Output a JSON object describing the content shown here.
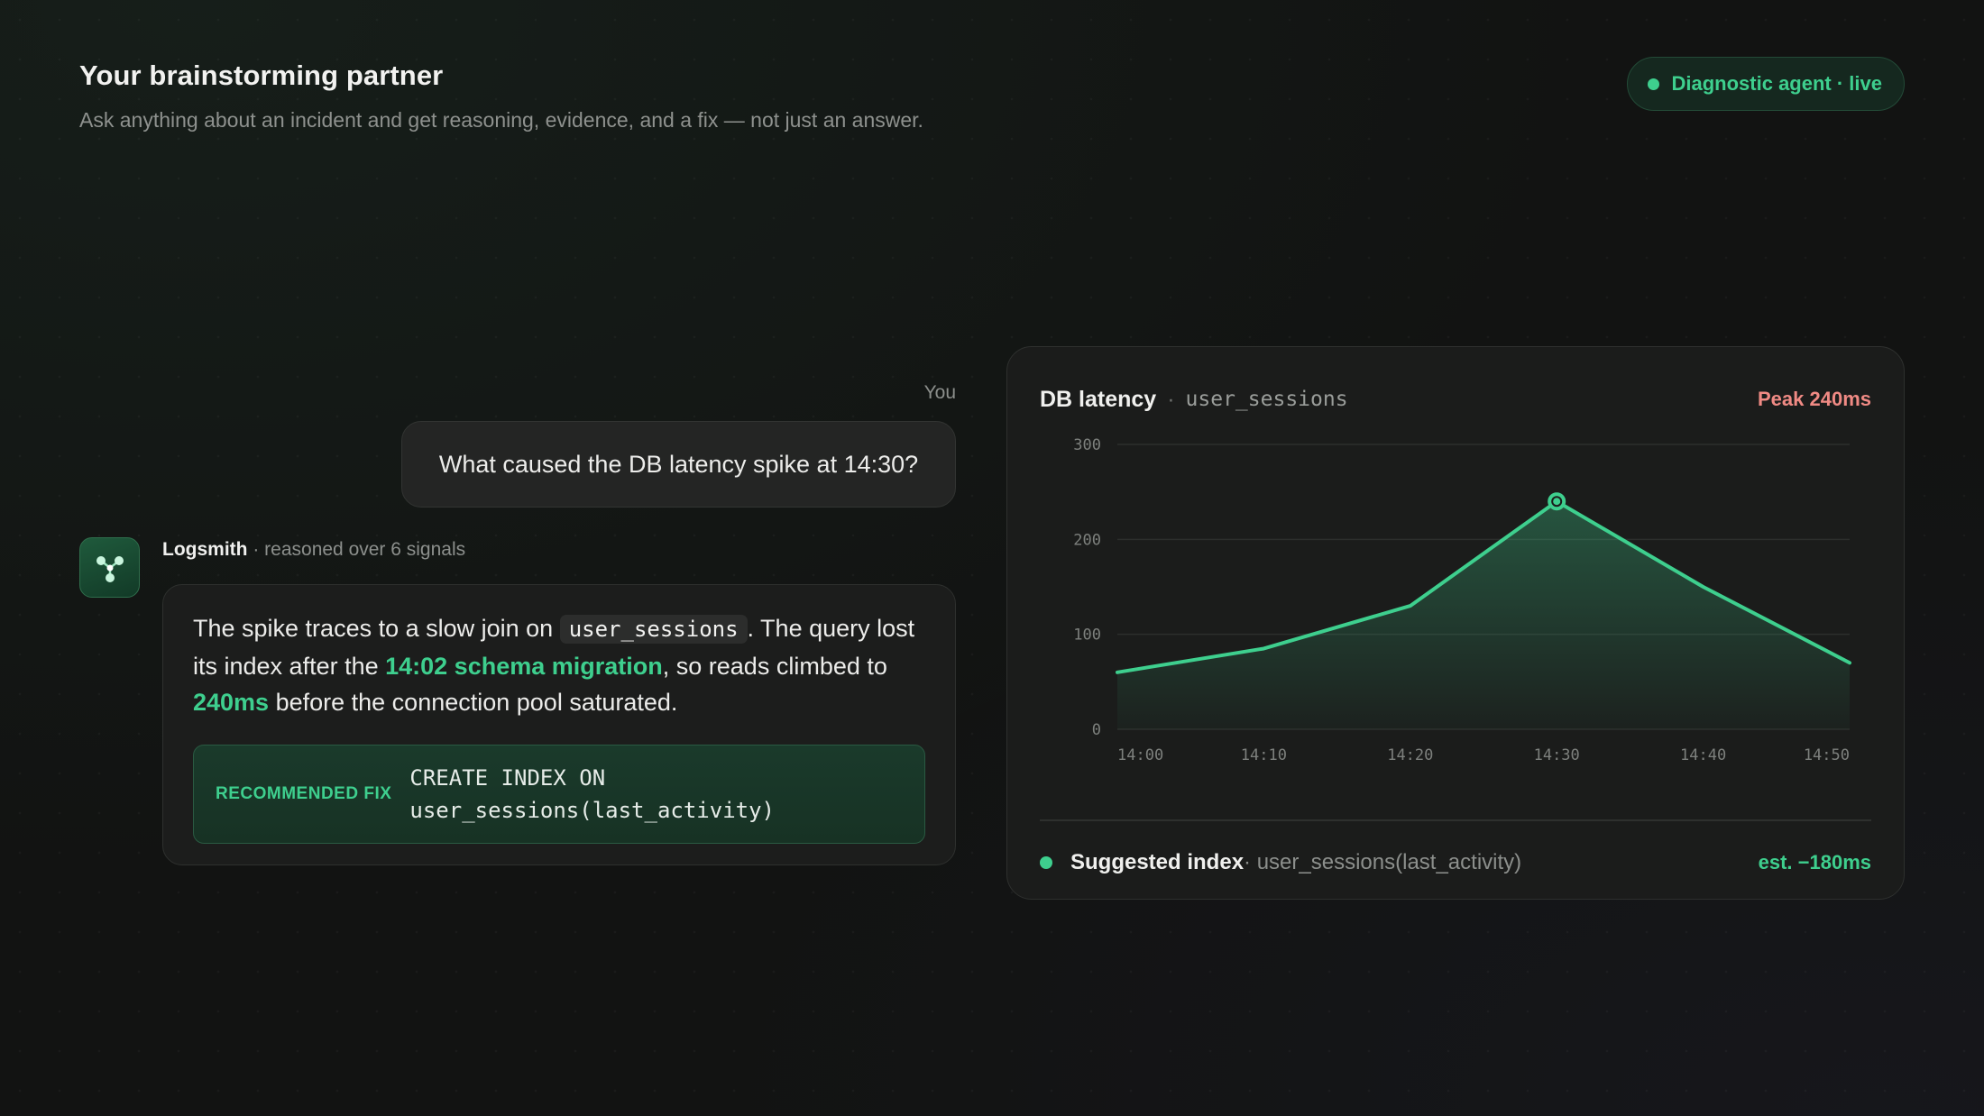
{
  "header": {
    "title": "Your brainstorming partner",
    "subtitle": "Ask anything about an incident and get reasoning, evidence, and a fix — not just an answer."
  },
  "status": {
    "label": "Diagnostic agent · live"
  },
  "chat": {
    "user_label": "You",
    "user_message": "What caused the DB latency spike at 14:30?",
    "agent_name": "Logsmith",
    "agent_meta": " · reasoned over 6 signals",
    "agent_text": {
      "p1": "The spike traces to a slow join on ",
      "code": "user_sessions",
      "p2": ". The query lost its index after the ",
      "highlight1": "14:02 schema migration",
      "p3": ", so reads climbed to ",
      "highlight2": "240ms",
      "p4": " before the connection pool saturated."
    },
    "fix": {
      "label": "RECOMMENDED FIX",
      "line1": "CREATE INDEX ON",
      "line2": "user_sessions(last_activity)"
    }
  },
  "card": {
    "title": "DB latency",
    "separator": "·",
    "table": "user_sessions",
    "peak": "Peak 240ms",
    "footer": {
      "label": "Suggested index",
      "detail": " · user_sessions(last_activity)",
      "estimate": "est. −180ms"
    }
  },
  "colors": {
    "accent": "#3ecf8e",
    "peak": "#f08a84"
  },
  "icons": {
    "avatar": "network-nodes-icon",
    "status": "live-dot-icon"
  },
  "chart_data": {
    "type": "area",
    "x": [
      "14:00",
      "14:10",
      "14:20",
      "14:30",
      "14:40",
      "14:50"
    ],
    "points": [
      {
        "x": 0,
        "y": 60
      },
      {
        "x": 10,
        "y": 85
      },
      {
        "x": 20,
        "y": 130
      },
      {
        "x": 30,
        "y": 240
      },
      {
        "x": 40,
        "y": 150
      },
      {
        "x": 50,
        "y": 70
      }
    ],
    "highlight_point": 3,
    "yticks": [
      0,
      100,
      200,
      300
    ],
    "ylim": [
      0,
      300
    ],
    "xlim": [
      0,
      50
    ],
    "grid": true,
    "xlabel": "",
    "ylabel": ""
  }
}
